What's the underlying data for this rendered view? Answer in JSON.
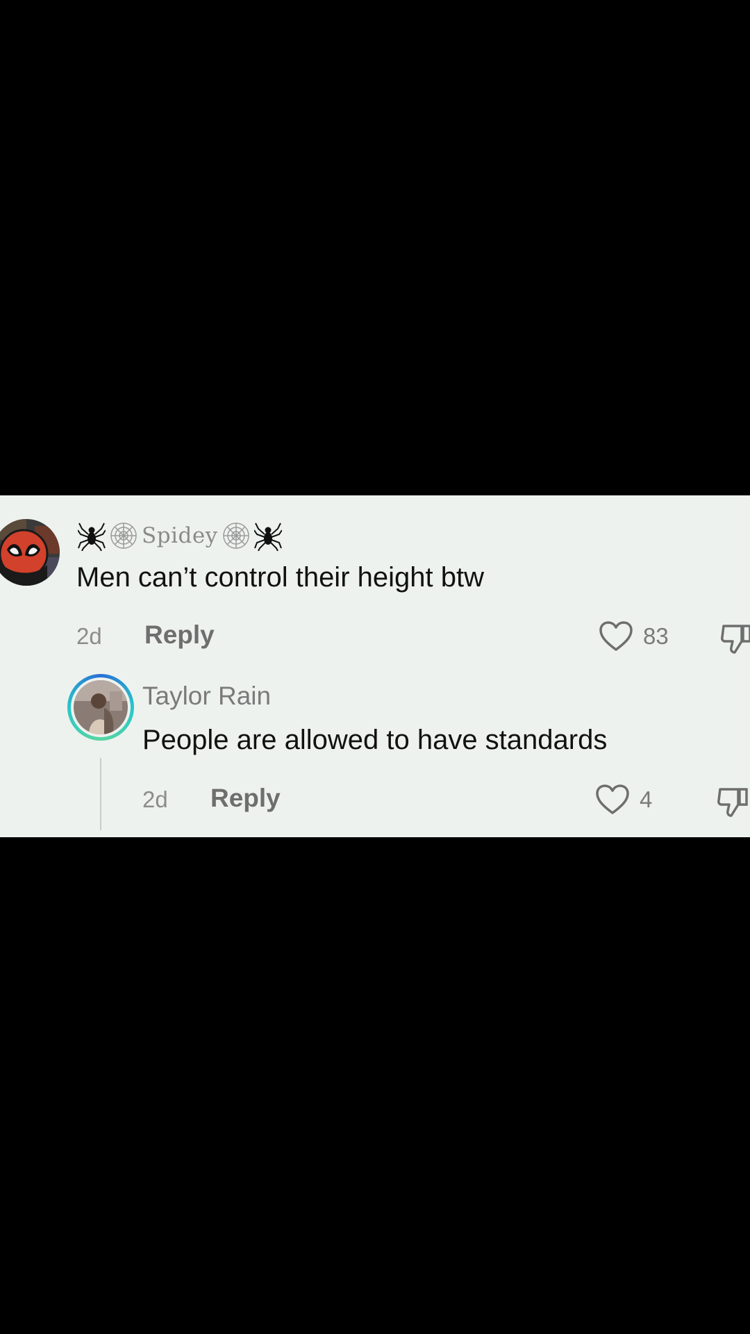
{
  "comment": {
    "username": "Spidey",
    "text": "Men can’t control their height btw",
    "time": "2d",
    "reply_label": "Reply",
    "likes": "83"
  },
  "reply": {
    "username": "Taylor Rain",
    "text": "People are allowed to have standards",
    "time": "2d",
    "reply_label": "Reply",
    "likes": "4"
  },
  "icons": {
    "like": "heart-outline-icon",
    "dislike": "thumbs-down-icon",
    "username_decor": [
      "spider-icon",
      "spiderweb-icon",
      "spiderweb-icon",
      "spider-icon"
    ]
  },
  "colors": {
    "panel_background": "#eef2ef",
    "letterbox": "#000000",
    "avatar_ring_start": "#2a6fd6",
    "avatar_ring_end": "#5ad6a0",
    "spidey_red": "#d2412c"
  }
}
